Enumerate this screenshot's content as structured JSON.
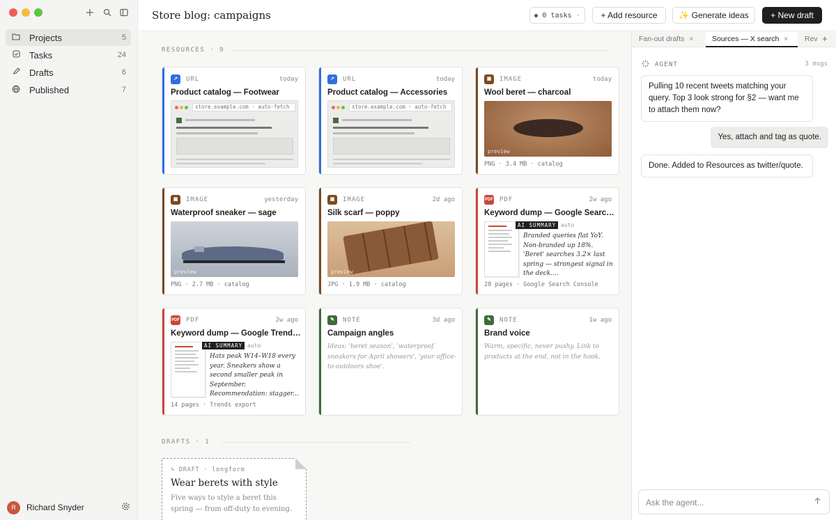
{
  "app": {
    "title": "Store blog: campaigns"
  },
  "sidebar": {
    "items": [
      {
        "label": "Projects",
        "count": "5",
        "icon": "folder-icon"
      },
      {
        "label": "Tasks",
        "count": "24",
        "icon": "checkbox-icon"
      },
      {
        "label": "Drafts",
        "count": "6",
        "icon": "pencil-icon"
      },
      {
        "label": "Published",
        "count": "7",
        "icon": "globe-icon"
      }
    ],
    "user": {
      "name": "Richard Snyder",
      "initial": "R"
    }
  },
  "header": {
    "tasks_label": "0 tasks",
    "add_resource": "+ Add resource",
    "generate_ideas": "✨ Generate ideas",
    "new_draft": "+ New draft"
  },
  "resources": {
    "title": "RESOURCES",
    "count": "9",
    "cards": [
      {
        "kind": "URL",
        "time": "today",
        "title": "Product catalog — Footwear",
        "url": "store.example.com · auto-fetch"
      },
      {
        "kind": "URL",
        "time": "today",
        "title": "Product catalog — Accessories",
        "url": "store.example.com · auto-fetch"
      },
      {
        "kind": "IMAGE",
        "time": "today",
        "title": "Wool beret — charcoal",
        "preview": "preview",
        "meta": "PNG · 3.4 MB · catalog"
      },
      {
        "kind": "IMAGE",
        "time": "yesterday",
        "title": "Waterproof sneaker — sage",
        "preview": "preview",
        "meta": "PNG · 2.7 MB · catalog"
      },
      {
        "kind": "IMAGE",
        "time": "2d ago",
        "title": "Silk scarf — poppy",
        "preview": "preview",
        "meta": "JPG · 1.9 MB · catalog"
      },
      {
        "kind": "PDF",
        "time": "2w ago",
        "title": "Keyword dump — Google Search ...",
        "ai_tag": "AI SUMMARY",
        "auto": "auto",
        "summary": "Branded queries flat YoY. Non-branded up 18%. 'Beret' searches 3.2× last spring — strongest signal in the deck....",
        "meta": "28 pages · Google Search Console"
      },
      {
        "kind": "PDF",
        "time": "2w ago",
        "title": "Keyword dump — Google Trends ...",
        "ai_tag": "AI SUMMARY",
        "auto": "auto",
        "summary": "Hats peak W14–W18 every year. Sneakers show a second smaller peak in September. Recommendation: stagger...",
        "meta": "14 pages · Trends export"
      },
      {
        "kind": "NOTE",
        "time": "3d ago",
        "title": "Campaign angles",
        "body": "Ideas: 'beret season', 'waterproof sneakers for April showers', 'your office-to-outdoors shoe'."
      },
      {
        "kind": "NOTE",
        "time": "1w ago",
        "title": "Brand voice",
        "body": "Warm, specific, never pushy. Link to products at the end, not in the hook."
      }
    ]
  },
  "drafts": {
    "title": "DRAFTS",
    "count": "1",
    "card": {
      "kind": "DRAFT",
      "format": "longform",
      "title": "Wear berets with style",
      "body": "Five ways to style a beret this spring — from off-duty to evening."
    }
  },
  "panel": {
    "tabs": [
      "Fan-out drafts",
      "Sources — X search",
      "Rev"
    ],
    "agent_label": "AGENT",
    "msg_count": "3 msgs",
    "messages": [
      {
        "role": "agent",
        "text": "Pulling 10 recent tweets matching your query. Top 3 look strong for §2 — want me to attach them now?"
      },
      {
        "role": "user",
        "text": "Yes, attach and tag as quote."
      },
      {
        "role": "agent",
        "text": "Done. Added to Resources as twitter/quote."
      }
    ],
    "input_placeholder": "Ask the agent..."
  },
  "colors": {
    "url": "#2f6fe0",
    "image": "#7a4a22",
    "pdf": "#c8473a",
    "note": "#3f6b3a"
  }
}
